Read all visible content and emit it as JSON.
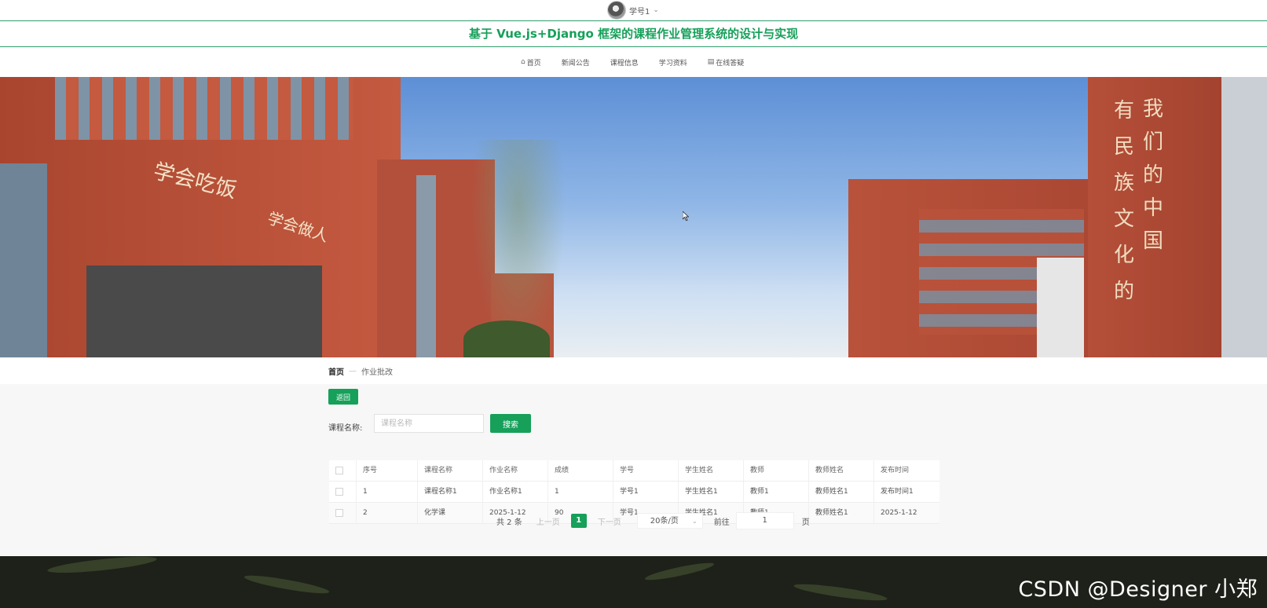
{
  "user": {
    "name": "学号1"
  },
  "site": {
    "title": "基于 Vue.js+Django 框架的课程作业管理系统的设计与实现"
  },
  "nav": {
    "items": [
      {
        "label": "首页",
        "icon": "home-icon"
      },
      {
        "label": "新闻公告"
      },
      {
        "label": "课程信息"
      },
      {
        "label": "学习资料"
      },
      {
        "label": "在线答疑",
        "icon": "book-icon"
      }
    ]
  },
  "banner": {
    "signs": [
      "学会吃饭",
      "学会做人",
      "我们的中国",
      "有民族文化的"
    ]
  },
  "breadcrumb": {
    "home": "首页",
    "separator": "—",
    "current": "作业批改"
  },
  "toolbar": {
    "back_label": "返回"
  },
  "search": {
    "label": "课程名称:",
    "placeholder": "课程名称",
    "button_label": "搜索"
  },
  "table": {
    "headers": [
      "序号",
      "课程名称",
      "作业名称",
      "成绩",
      "学号",
      "学生姓名",
      "教师",
      "教师姓名",
      "发布时间"
    ],
    "rows": [
      [
        "1",
        "课程名称1",
        "作业名称1",
        "1",
        "学号1",
        "学生姓名1",
        "教师1",
        "教师姓名1",
        "发布时间1"
      ],
      [
        "2",
        "化学课",
        "2025-1-12",
        "90",
        "学号1",
        "学生姓名1",
        "教师1",
        "教师姓名1",
        "2025-1-12"
      ]
    ]
  },
  "pagination": {
    "total": "共 2 条",
    "prev": "上一页",
    "current": "1",
    "next": "下一页",
    "page_size": "20条/页",
    "goto": "前往",
    "page_input": "1",
    "page_unit": "页"
  },
  "watermark": "CSDN @Designer 小郑",
  "colors": {
    "accent": "#16a05a",
    "border": "#2f9e6e",
    "footer": "#1e2119"
  }
}
